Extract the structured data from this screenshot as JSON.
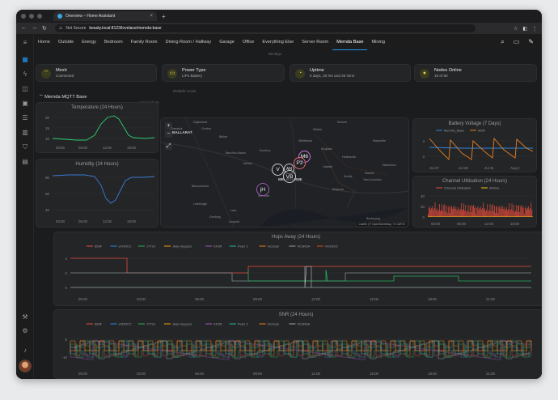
{
  "browser": {
    "tab_title": "Overview – Home Assistant",
    "not_secure": "Not Secure",
    "url": "beasty.local:8123/lovelace/mernda-base"
  },
  "header": {
    "tabs": [
      "Home",
      "Outside",
      "Energy",
      "Bedroom",
      "Family Room",
      "Dining Room / Hallway",
      "Garage",
      "Office",
      "Everything Else",
      "Server Room",
      "Mernda Base",
      "Mining"
    ],
    "active_tab": "Mernda Base"
  },
  "entities": [
    {
      "title": "Mesh",
      "state": "Connected",
      "icon": "mesh-icon"
    },
    {
      "title": "Power Type",
      "state": "LiPo Battery",
      "icon": "battery-icon"
    },
    {
      "title": "Uptime",
      "state": "5 days, 20 hrs and 26 mins",
      "icon": "uptime-icon"
    },
    {
      "title": "Nodes Online",
      "state": "19 of 80",
      "icon": "nodes-icon"
    }
  ],
  "section": {
    "title": "Mernda MQTT Base"
  },
  "colors": {
    "accent": "#2196f3",
    "temp": "#2ecc71",
    "humidity": "#3a7bd5",
    "voltage_blue": "#2e86de",
    "voltage_orange": "#e67e22",
    "util_red": "#e74c3c",
    "util_yellow": "#f1c40f"
  },
  "temperature": {
    "title": "Temperature (24 Hours)",
    "y_ticks": [
      "20",
      "15",
      "10"
    ],
    "x_ticks": [
      "00:00",
      "06:00",
      "12:00",
      "18:00"
    ]
  },
  "humidity": {
    "title": "Humidity (24 Hours)",
    "y_ticks": [
      "80",
      "60",
      "40"
    ],
    "x_ticks": [
      "00:00",
      "06:00",
      "12:00",
      "18:00"
    ]
  },
  "map": {
    "nodes": [
      {
        "label": "M6",
        "color": "#c678dd"
      },
      {
        "label": "P2",
        "color": "#e06c75"
      },
      {
        "label": "V",
        "color": "#cccccc"
      },
      {
        "label": "AN",
        "color": "#cccccc"
      },
      {
        "label": "VB",
        "color": "#cccccc"
      },
      {
        "label": "jH",
        "color": "#9b59b6"
      }
    ],
    "places": [
      "Daylesford",
      "Creswick",
      "Gordon",
      "Ballan",
      "Bacchus Marsh",
      "Sunbury",
      "Melton",
      "Whittlesea",
      "Marysville",
      "Healesville",
      "Lilydale",
      "Warburton",
      "Seville",
      "Wandin",
      "Yarra Junction",
      "Belgrave",
      "Geelong",
      "Lara",
      "Leopold",
      "Werribee",
      "Lethbridge",
      "Bannockburn",
      "Melbourne",
      "Wallan",
      "Kilmore",
      "Kinglake",
      "Buninyong"
    ],
    "ballarat": "BALLARAT",
    "melbourne": "MELBOURNE",
    "attribution": "Leaflet | © OpenStreetMap, © CARTO"
  },
  "battery": {
    "title": "Battery Voltage (7 Days)",
    "legend": [
      "Mernda_Base",
      "669F"
    ],
    "y_ticks": [
      "4",
      "3"
    ],
    "x_ticks": [
      "Jul 27",
      "Jul 29",
      "Jul 31",
      "Aug 2"
    ]
  },
  "utilisation": {
    "title": "Channel Utilisation (24 Hours)",
    "legend": [
      "Channel Utilisation",
      "Airtime"
    ],
    "y_ticks": [
      "40",
      "20",
      "0"
    ],
    "x_ticks": [
      "00:00",
      "06:00",
      "12:00",
      "18:00"
    ]
  },
  "hops": {
    "title": "Hops Away (24 Hours)",
    "legend": [
      "669F",
      "aTDRCC",
      "JTTnn",
      "Jelly Hoppers",
      "KF3R",
      "Peter 2",
      "VicScan",
      "VK3RDA",
      "VK3SVD"
    ],
    "y_ticks": [
      "4",
      "2",
      "0"
    ],
    "x_ticks": [
      "00:00",
      "03:00",
      "06:00",
      "09:00",
      "12:00",
      "15:00",
      "18:00",
      "21:00"
    ]
  },
  "snr": {
    "title": "SNR (24 Hours)",
    "legend": [
      "669F",
      "aTDRCC",
      "JTTnn",
      "Jelly Hoppers",
      "KF3R",
      "Peter 2",
      "VicScan",
      "VK3RDA"
    ],
    "y_ticks": [
      "0",
      "-10"
    ],
    "x_ticks": [
      "00:00",
      "03:00",
      "06:00",
      "09:00",
      "12:00",
      "15:00",
      "18:00",
      "21:00"
    ]
  },
  "background_labels": [
    "Bendigo",
    "Riddells Creek",
    "Craigieburn",
    "Ocean Grove",
    "Long Long",
    "Hastings"
  ]
}
